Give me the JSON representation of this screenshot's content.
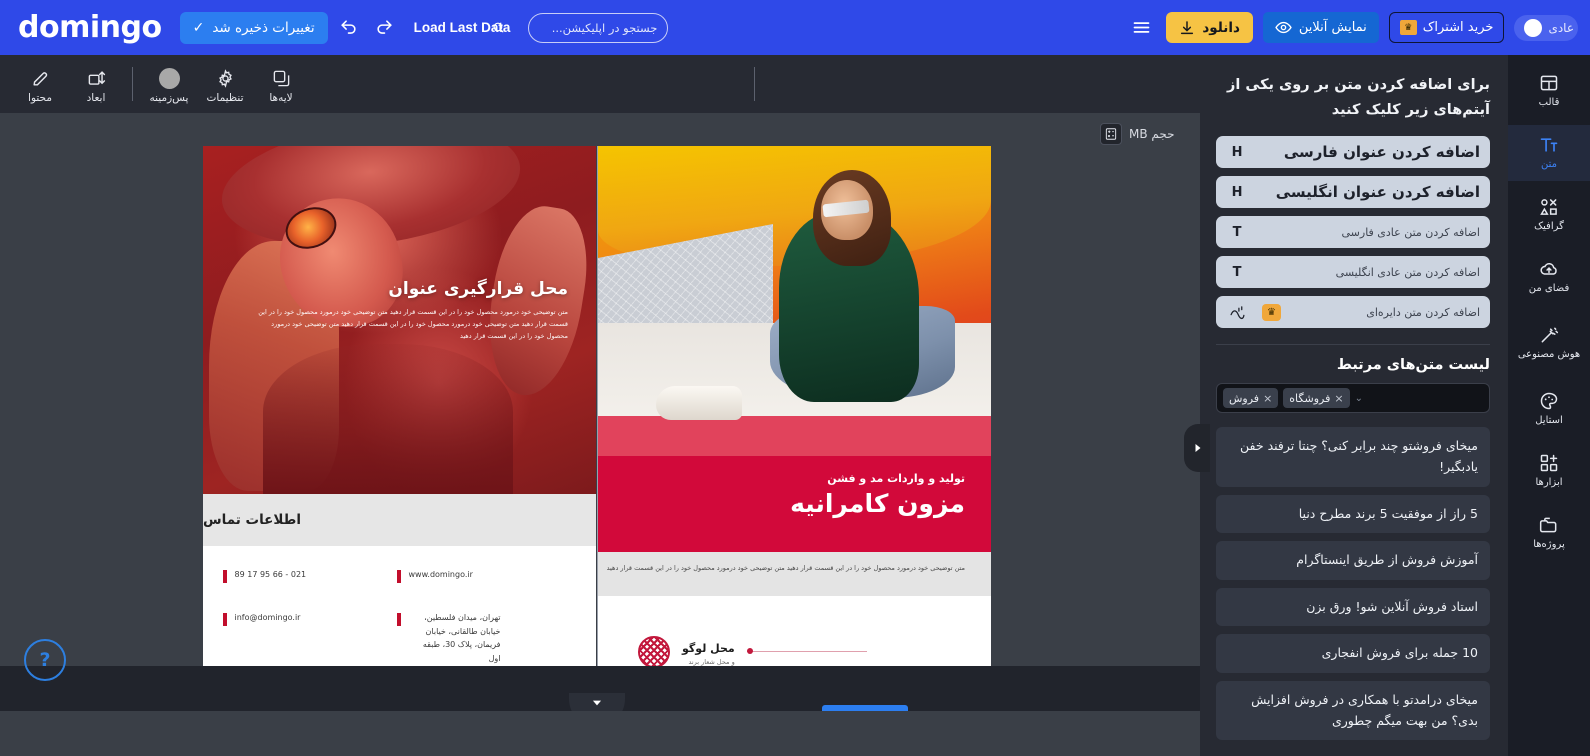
{
  "topbar": {
    "logo": "domingo",
    "saved_label": "تغییرات ذخیره شد",
    "check_icon": "✓",
    "undo_icon": "undo-icon",
    "redo_icon": "redo-icon",
    "load_last_data": "Load Last Data",
    "search_placeholder": "جستجو در اپلیکیشن...",
    "search_value": "",
    "toggle_label": "عادی",
    "subscription_label": "خرید اشتراک",
    "crown_icon": "♛",
    "online_preview_label": "نمایش آنلاین",
    "download_label": "دانلود",
    "menu_icon": "hamburger-icon",
    "accent_blue": "#2f49e8",
    "accent_yellow": "#f6c344"
  },
  "lefttools": [
    {
      "label": "لایه‌ها",
      "icon": "layers-icon"
    },
    {
      "label": "تنظیمات",
      "icon": "gear-icon"
    },
    {
      "label": "پس‌زمینه",
      "icon": "circle-icon"
    },
    {
      "label": "ابعاد",
      "icon": "resize-icon"
    },
    {
      "label": "محتوا",
      "icon": "pencil-icon"
    }
  ],
  "canvas": {
    "size_badge_label": "حجم MB",
    "size_badge_icon": "calculator-icon",
    "collapse_icon": "chevron-right-icon",
    "bottom_tab_icon": "chevron-down-icon",
    "help_label": "?",
    "left_page": {
      "hero_title": "محل قرارگیری عنوان",
      "hero_body": "متن توضیحی خود درمورد محصول خود را در این قسمت قرار دهید  متن توضیحی خود درمورد محصول خود را در این قسمت قرار دهید  متن توضیحی خود درمورد محصول خود را در این قسمت قرار دهید  متن توضیحی خود درمورد محصول خود را در این قسمت قرار دهید",
      "contact_header": "اطلاعات تماس",
      "phone": "021 - 66 95 17 89",
      "email": "info@domingo.ir",
      "website": "www.domingo.ir",
      "address": "تهران، میدان فلسطین، خیابان طالقانی، خیابان فریمان، پلاک 30، طبقه اول"
    },
    "right_page": {
      "banner_sub": "تولید و واردات مد و فشن",
      "banner_title": "مزون کامرانیه",
      "desc": "متن توضیحی خود درمورد محصول خود را در این قسمت قرار دهید متن توضیحی خود درمورد محصول خود را در این قسمت قرار دهید",
      "logo_title": "محل لوگو",
      "logo_sub": "و محل شعار برند"
    }
  },
  "panel": {
    "hint": "برای اضافه کردن متن بر روی یکی از آیتم‌های زیر کلیک کنید",
    "add_items": [
      {
        "label": "اضافه کردن عنوان فارسی",
        "icon": "H",
        "size": "big",
        "pro": false
      },
      {
        "label": "اضافه کردن عنوان انگلیسی",
        "icon": "H",
        "size": "big",
        "pro": false
      },
      {
        "label": "اضافه کردن متن عادی فارسی",
        "icon": "T",
        "size": "small",
        "pro": false
      },
      {
        "label": "اضافه کردن متن عادی انگلیسی",
        "icon": "T",
        "size": "small",
        "pro": false
      },
      {
        "label": "اضافه کردن متن دایره‌ای",
        "icon": "curve-text-icon",
        "size": "small",
        "pro": true
      }
    ],
    "related_title": "لیست متن‌های مرتبط",
    "tags": [
      "فروش",
      "فروشگاه"
    ],
    "tag_remove_icon": "×",
    "tag_chevron_icon": "chevron-down-icon",
    "texts": [
      "میخای فروشتو چند برابر کنی؟ چنتا ترفند خفن یادبگیر!",
      "5 راز از موفقیت 5 برند مطرح دنیا",
      "آموزش فروش از طریق اینستاگرام",
      "استاد فروش آنلاین شو! ورق بزن",
      "10 جمله برای فروش انفجاری",
      "میخای درامدتو با همکاری در فروش افزایش بدی؟ من بهت میگم چطوری"
    ]
  },
  "rail": [
    {
      "label": "قالب",
      "icon": "template-icon",
      "active": false
    },
    {
      "label": "متن",
      "icon": "text-icon",
      "active": true
    },
    {
      "label": "گرافیک",
      "icon": "graphics-icon",
      "active": false
    },
    {
      "label": "فضای من",
      "icon": "cloud-upload-icon",
      "active": false
    },
    {
      "label": "هوش مصنوعی",
      "icon": "magic-wand-icon",
      "active": false
    },
    {
      "label": "استایل",
      "icon": "palette-icon",
      "active": false
    },
    {
      "label": "ابزارها",
      "icon": "tools-grid-icon",
      "active": false
    },
    {
      "label": "پروژه‌ها",
      "icon": "folders-icon",
      "active": false
    }
  ]
}
